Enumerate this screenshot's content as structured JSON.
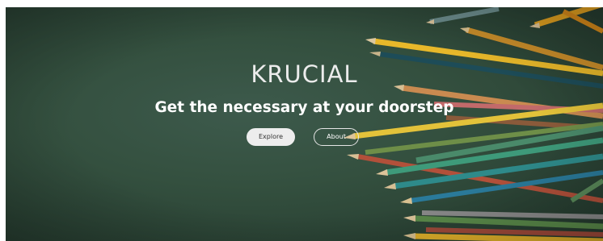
{
  "hero": {
    "title": "KRUCIAL",
    "tagline": "Get the necessary at your doorstep",
    "buttons": {
      "explore_label": "Explore",
      "about_label": "About"
    }
  },
  "colors": {
    "background": "#34503f",
    "title_text": "#ececec",
    "explore_button_bg": "#ededed",
    "about_button_border": "#e6e6e6"
  },
  "icons": {
    "background_image": "colored-pencils-image"
  }
}
